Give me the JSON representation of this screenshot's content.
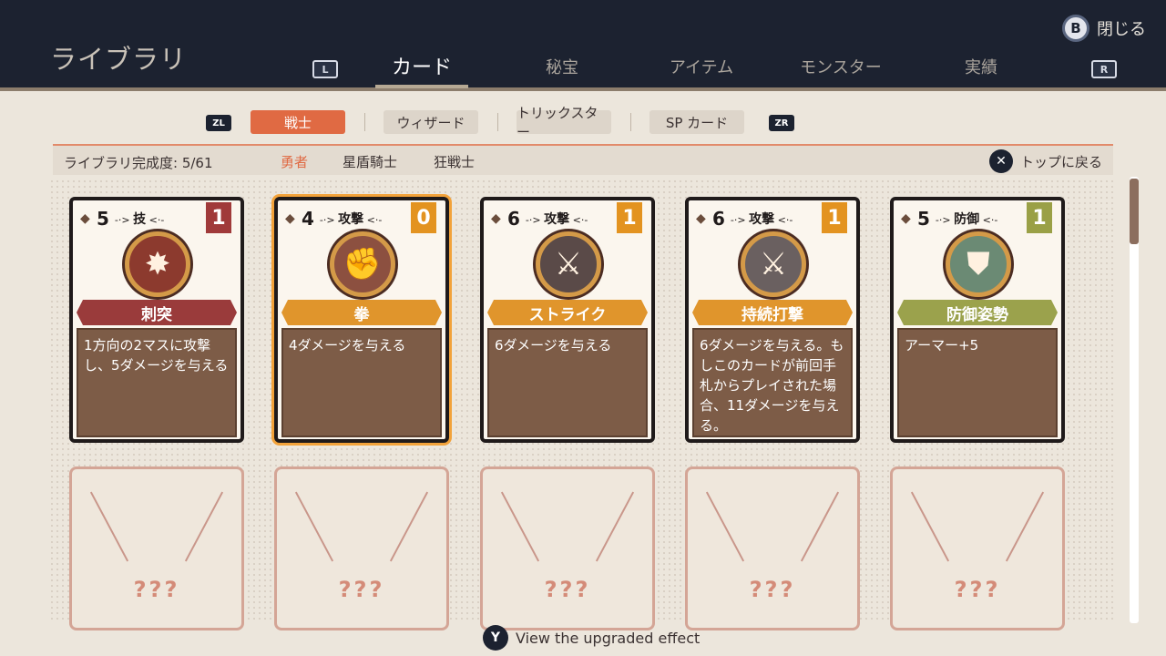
{
  "header": {
    "title": "ライブラリ",
    "close_button": "B",
    "close_label": "閉じる",
    "bumper_left": "L",
    "bumper_right": "R",
    "tabs": [
      "カード",
      "秘宝",
      "アイテム",
      "モンスター",
      "実績"
    ]
  },
  "subtabs": {
    "left_button": "ZL",
    "right_button": "ZR",
    "items": [
      "戦士",
      "ウィザード",
      "トリックスター",
      "SP カード"
    ]
  },
  "info": {
    "completion": "ライブラリ完成度: 5/61",
    "filters": [
      "勇者",
      "星盾騎士",
      "狂戦士"
    ],
    "back_button": "✕",
    "back_label": "トップに戻る"
  },
  "cards": [
    {
      "cost": "5",
      "cost_icon": "drop-icon",
      "type": "技",
      "rarity": "1",
      "rarity_color": "#a03a3a",
      "art_color": "#8c3a2e",
      "art_icon": "burst-dagger-icon",
      "art_glyph": "✸",
      "name": "刺突",
      "banner_color": "#9a3b3b",
      "description": "1方向の2マスに攻撃し、5ダメージを与える"
    },
    {
      "cost": "4",
      "cost_icon": "sword-icon",
      "type": "攻撃",
      "rarity": "0",
      "rarity_color": "#e39320",
      "art_color": "#8c5040",
      "art_icon": "fist-icon",
      "art_glyph": "✊",
      "name": "拳",
      "banner_color": "#e0952c",
      "description": "4ダメージを与える"
    },
    {
      "cost": "6",
      "cost_icon": "sword-icon",
      "type": "攻撃",
      "rarity": "1",
      "rarity_color": "#e39320",
      "art_color": "#5a4a48",
      "art_icon": "greatsword-icon",
      "art_glyph": "⚔",
      "name": "ストライク",
      "banner_color": "#e0952c",
      "description": "6ダメージを与える"
    },
    {
      "cost": "6",
      "cost_icon": "sword-icon",
      "type": "攻撃",
      "rarity": "1",
      "rarity_color": "#e39320",
      "art_color": "#6a6060",
      "art_icon": "twin-swords-icon",
      "art_glyph": "⚔",
      "name": "持続打撃",
      "banner_color": "#e0952c",
      "description": "6ダメージを与える。もしこのカードが前回手札からプレイされた場合、11ダメージを与える。"
    },
    {
      "cost": "5",
      "cost_icon": "shield-small-icon",
      "type": "防御",
      "rarity": "1",
      "rarity_color": "#9aa046",
      "art_color": "#6b8a74",
      "art_icon": "shield-icon",
      "art_glyph": "⛊",
      "name": "防御姿勢",
      "banner_color": "#9ba24c",
      "description": "アーマー+5"
    }
  ],
  "locked_cards": [
    "???",
    "???",
    "???",
    "???",
    "???"
  ],
  "footer": {
    "button": "Y",
    "hint": "View the upgraded effect"
  }
}
